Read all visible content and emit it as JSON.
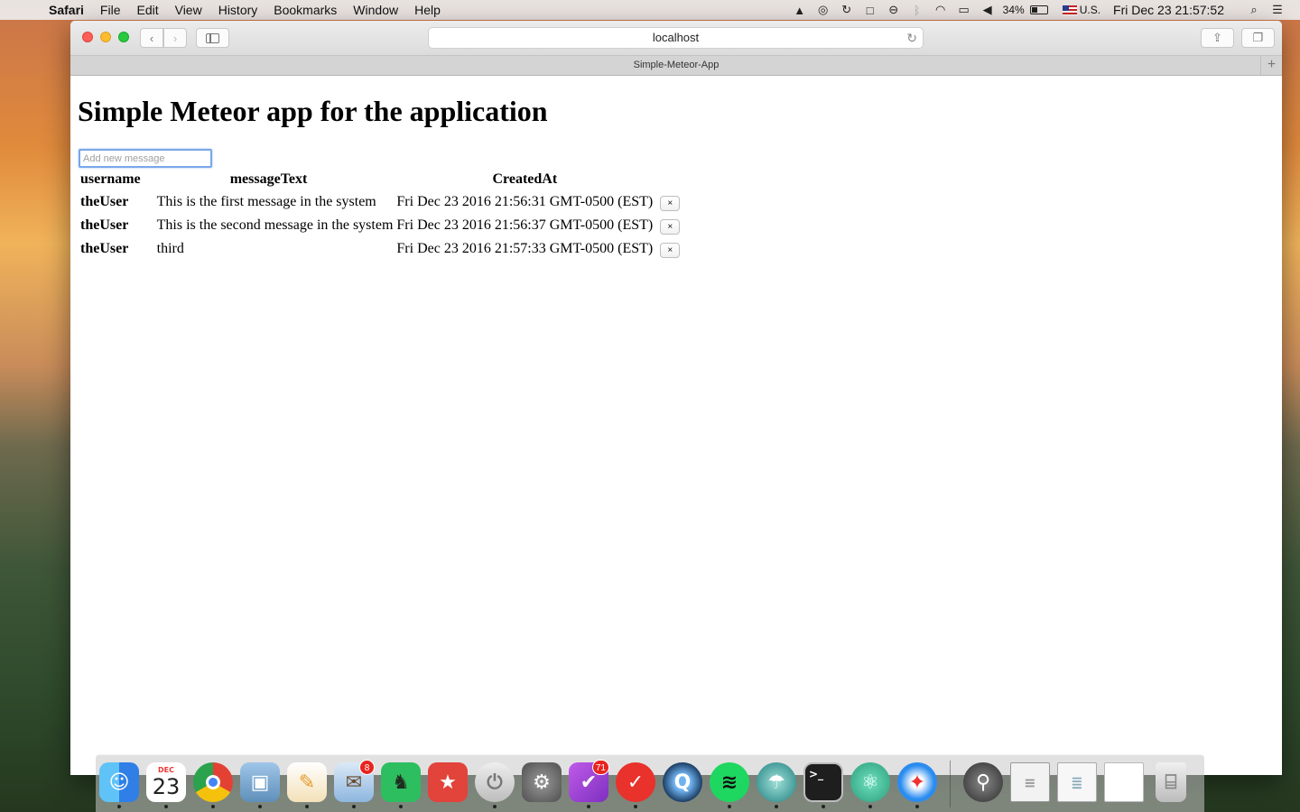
{
  "menubar": {
    "app_name": "Safari",
    "items": [
      "File",
      "Edit",
      "View",
      "History",
      "Bookmarks",
      "Window",
      "Help"
    ],
    "battery": "34%",
    "input_source": "U.S.",
    "clock": "Fri Dec 23  21:57:52"
  },
  "browser": {
    "address": "localhost",
    "tab_title": "Simple-Meteor-App"
  },
  "page": {
    "title": "Simple Meteor app for the application",
    "input_placeholder": "Add new message",
    "table": {
      "headers": [
        "username",
        "messageText",
        "CreatedAt"
      ],
      "rows": [
        {
          "username": "theUser",
          "text": "This is the first message in the system",
          "created": "Fri Dec 23 2016 21:56:31 GMT-0500 (EST)",
          "delete": "×"
        },
        {
          "username": "theUser",
          "text": "This is the second message in the system",
          "created": "Fri Dec 23 2016 21:56:37 GMT-0500 (EST)",
          "delete": "×"
        },
        {
          "username": "theUser",
          "text": "third",
          "created": "Fri Dec 23 2016 21:57:33 GMT-0500 (EST)",
          "delete": "×"
        }
      ]
    }
  },
  "dock": {
    "calendar_month": "DEC",
    "calendar_day": "23",
    "mail_badge": "8",
    "omnifocus_badge": "71",
    "apps": [
      {
        "icon": "finder-icon",
        "color": "#2f8ef0"
      },
      {
        "icon": "calendar-icon",
        "color": "#ffffff"
      },
      {
        "icon": "chrome-icon",
        "color": "#e34133"
      },
      {
        "icon": "preview-icon",
        "color": "#6d8fb3"
      },
      {
        "icon": "pages-icon",
        "color": "#f3a93a"
      },
      {
        "icon": "mail-icon",
        "color": "#6a9fd8"
      },
      {
        "icon": "evernote-icon",
        "color": "#2dbe60"
      },
      {
        "icon": "bookmark-app-icon",
        "color": "#e2433a"
      },
      {
        "icon": "shutdown-icon",
        "color": "#c7c7c7"
      },
      {
        "icon": "system-preferences-icon",
        "color": "#7c7c7c"
      },
      {
        "icon": "omnifocus-icon",
        "color": "#9c3ed6"
      },
      {
        "icon": "wunderlist-icon",
        "color": "#e8322b"
      },
      {
        "icon": "quicktime-icon",
        "color": "#2b5a8a"
      },
      {
        "icon": "spotify-icon",
        "color": "#1ed760"
      },
      {
        "icon": "island-app-icon",
        "color": "#2f9e9e"
      },
      {
        "icon": "terminal-icon",
        "color": "#1e1e1e"
      },
      {
        "icon": "atom-icon",
        "color": "#4dc6a1"
      },
      {
        "icon": "safari-icon",
        "color": "#2a8cf0"
      },
      {
        "icon": "alfred-icon",
        "color": "#3a3a3a"
      },
      {
        "icon": "document-icon",
        "color": "#f2f2f2"
      },
      {
        "icon": "document-icon",
        "color": "#f7f7f7"
      },
      {
        "icon": "document-icon",
        "color": "#ffffff"
      },
      {
        "icon": "trash-icon",
        "color": "#d8d8d8"
      }
    ]
  }
}
